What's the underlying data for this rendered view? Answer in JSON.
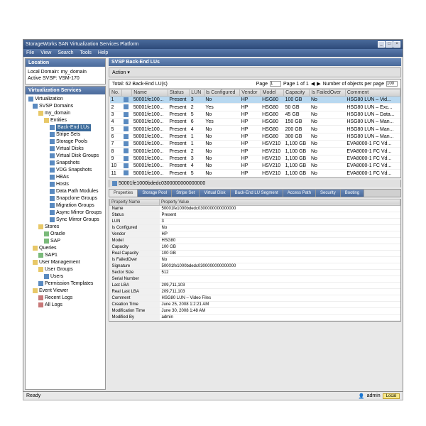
{
  "window": {
    "title": "StorageWorks SAN Virtualization Services Platform"
  },
  "menu": [
    "File",
    "View",
    "Search",
    "Tools",
    "Help"
  ],
  "location": {
    "header": "Location",
    "domain_label": "Local Domain:",
    "domain": "my_domain",
    "svsp_label": "Active SVSP:",
    "svsp": "VSM-170"
  },
  "vs": {
    "header": "Virtualization Services"
  },
  "tree": [
    {
      "l": 0,
      "t": "Virtualization",
      "ic": "b"
    },
    {
      "l": 1,
      "t": "SVSP Domains",
      "ic": "b"
    },
    {
      "l": 2,
      "t": "my_domain",
      "ic": "f"
    },
    {
      "l": 3,
      "t": "Entities",
      "ic": "f"
    },
    {
      "l": 4,
      "t": "Back-End LUs",
      "ic": "b",
      "sel": true
    },
    {
      "l": 4,
      "t": "Stripe Sets",
      "ic": "b"
    },
    {
      "l": 4,
      "t": "Storage Pools",
      "ic": "b"
    },
    {
      "l": 4,
      "t": "Virtual Disks",
      "ic": "b"
    },
    {
      "l": 4,
      "t": "Virtual Disk Groups",
      "ic": "b"
    },
    {
      "l": 4,
      "t": "Snapshots",
      "ic": "b"
    },
    {
      "l": 4,
      "t": "VDG Snapshots",
      "ic": "b"
    },
    {
      "l": 4,
      "t": "HBAs",
      "ic": "b"
    },
    {
      "l": 4,
      "t": "Hosts",
      "ic": "b"
    },
    {
      "l": 4,
      "t": "Data Path Modules",
      "ic": "b"
    },
    {
      "l": 4,
      "t": "Snapclone Groups",
      "ic": "b"
    },
    {
      "l": 4,
      "t": "Migration Groups",
      "ic": "b"
    },
    {
      "l": 4,
      "t": "Async Mirror Groups",
      "ic": "b"
    },
    {
      "l": 4,
      "t": "Sync Mirror Groups",
      "ic": "b"
    },
    {
      "l": 2,
      "t": "Stores",
      "ic": "f"
    },
    {
      "l": 3,
      "t": "Oracle",
      "ic": "g"
    },
    {
      "l": 3,
      "t": "SAP",
      "ic": "g"
    },
    {
      "l": 1,
      "t": "Queries",
      "ic": "f"
    },
    {
      "l": 2,
      "t": "SAP1",
      "ic": "g"
    },
    {
      "l": 1,
      "t": "User Management",
      "ic": "f"
    },
    {
      "l": 2,
      "t": "User Groups",
      "ic": "f"
    },
    {
      "l": 3,
      "t": "Users",
      "ic": "b"
    },
    {
      "l": 2,
      "t": "Permission Templates",
      "ic": "b"
    },
    {
      "l": 1,
      "t": "Event Viewer",
      "ic": "f"
    },
    {
      "l": 2,
      "t": "Recent Logs",
      "ic": "r"
    },
    {
      "l": 2,
      "t": "All Logs",
      "ic": "r"
    }
  ],
  "content": {
    "header": "SVSP Back-End LUs",
    "action": "Action ▾",
    "total": "Total: 62 Back-End LU(s)",
    "page_lbl": "Page",
    "page": "1",
    "page_of": "Page 1 of 1",
    "num_lbl": "Number of objects per page",
    "num": "100"
  },
  "cols": [
    "No.",
    "",
    "Name",
    "Status",
    "LUN",
    "Is Configured",
    "Vendor",
    "Model",
    "Capacity",
    "Is FailedOver",
    "Comment"
  ],
  "rows": [
    {
      "n": "1",
      "name": "50001fe100...",
      "st": "Present",
      "lun": "3",
      "cfg": "No",
      "v": "HP",
      "m": "HSG80",
      "cap": "100 GB",
      "fo": "No",
      "c": "HSG80 LUN – Vid...",
      "sel": true
    },
    {
      "n": "2",
      "name": "50001fe100...",
      "st": "Present",
      "lun": "2",
      "cfg": "Yes",
      "v": "HP",
      "m": "HSG80",
      "cap": "50 GB",
      "fo": "No",
      "c": "HSG80 LUN – Exc..."
    },
    {
      "n": "3",
      "name": "50001fe100...",
      "st": "Present",
      "lun": "5",
      "cfg": "No",
      "v": "HP",
      "m": "HSG80",
      "cap": "45 GB",
      "fo": "No",
      "c": "HSG80 LUN – Data..."
    },
    {
      "n": "4",
      "name": "50001fe100...",
      "st": "Present",
      "lun": "6",
      "cfg": "Yes",
      "v": "HP",
      "m": "HSG80",
      "cap": "150 GB",
      "fo": "No",
      "c": "HSG80 LUN – Man..."
    },
    {
      "n": "5",
      "name": "50001fe100...",
      "st": "Present",
      "lun": "4",
      "cfg": "No",
      "v": "HP",
      "m": "HSG80",
      "cap": "200 GB",
      "fo": "No",
      "c": "HSG80 LUN – Man..."
    },
    {
      "n": "6",
      "name": "50001fe100...",
      "st": "Present",
      "lun": "1",
      "cfg": "No",
      "v": "HP",
      "m": "HSG80",
      "cap": "300 GB",
      "fo": "No",
      "c": "HSG80 LUN – Man..."
    },
    {
      "n": "7",
      "name": "50001fe100...",
      "st": "Present",
      "lun": "1",
      "cfg": "No",
      "v": "HP",
      "m": "HSV210",
      "cap": "1,100 GB",
      "fo": "No",
      "c": "EVA8000-1 FC Vd..."
    },
    {
      "n": "8",
      "name": "50001fe100...",
      "st": "Present",
      "lun": "2",
      "cfg": "No",
      "v": "HP",
      "m": "HSV210",
      "cap": "1,100 GB",
      "fo": "No",
      "c": "EVA8000-1 FC Vd..."
    },
    {
      "n": "9",
      "name": "50001fe100...",
      "st": "Present",
      "lun": "3",
      "cfg": "No",
      "v": "HP",
      "m": "HSV210",
      "cap": "1,100 GB",
      "fo": "No",
      "c": "EVA8000-1 FC Vd..."
    },
    {
      "n": "10",
      "name": "50001fe100...",
      "st": "Present",
      "lun": "4",
      "cfg": "No",
      "v": "HP",
      "m": "HSV210",
      "cap": "1,100 GB",
      "fo": "No",
      "c": "EVA8000-1 FC Vd..."
    },
    {
      "n": "11",
      "name": "50001fe100...",
      "st": "Present",
      "lun": "5",
      "cfg": "No",
      "v": "HP",
      "m": "HSV210",
      "cap": "1,100 GB",
      "fo": "No",
      "c": "EVA8000-1 FC Vd..."
    }
  ],
  "obj": "50001fe1000bdedc0300000000000000",
  "tabs": [
    "Properties",
    "Storage Pool",
    "Stripe Set",
    "Virtual Disk",
    "Back-End LU Segment",
    "Access Path",
    "Security",
    "Booting"
  ],
  "props_hdr": [
    "Property Name",
    "Property Value"
  ],
  "props": [
    [
      "Name",
      "50001fe1000bdedc0300000000000000"
    ],
    [
      "Status",
      "Present"
    ],
    [
      "LUN",
      "3"
    ],
    [
      "Is Configured",
      "No"
    ],
    [
      "Vendor",
      "HP"
    ],
    [
      "Model",
      "HSG80"
    ],
    [
      "Capacity",
      "100 GB"
    ],
    [
      "Real Capacity",
      "100 GB"
    ],
    [
      "Is FailedOver",
      "No"
    ],
    [
      "Signature",
      "50001fe1000bdedc0300000000000000"
    ],
    [
      "Sector Size",
      "512"
    ],
    [
      "Serial Number",
      ""
    ],
    [
      "Last LBA",
      "209,711,103"
    ],
    [
      "Real Last LBA",
      "209,711,103"
    ],
    [
      "Comment",
      "HSG80 LUN – Video Files"
    ],
    [
      "Creation Time",
      "June 25, 2008 1:2:21 AM"
    ],
    [
      "Modification Time",
      "June 30, 2008 1:48 AM"
    ],
    [
      "Modified By",
      "admin"
    ]
  ],
  "status": {
    "ready": "Ready",
    "user": "admin",
    "btn": "Local"
  }
}
